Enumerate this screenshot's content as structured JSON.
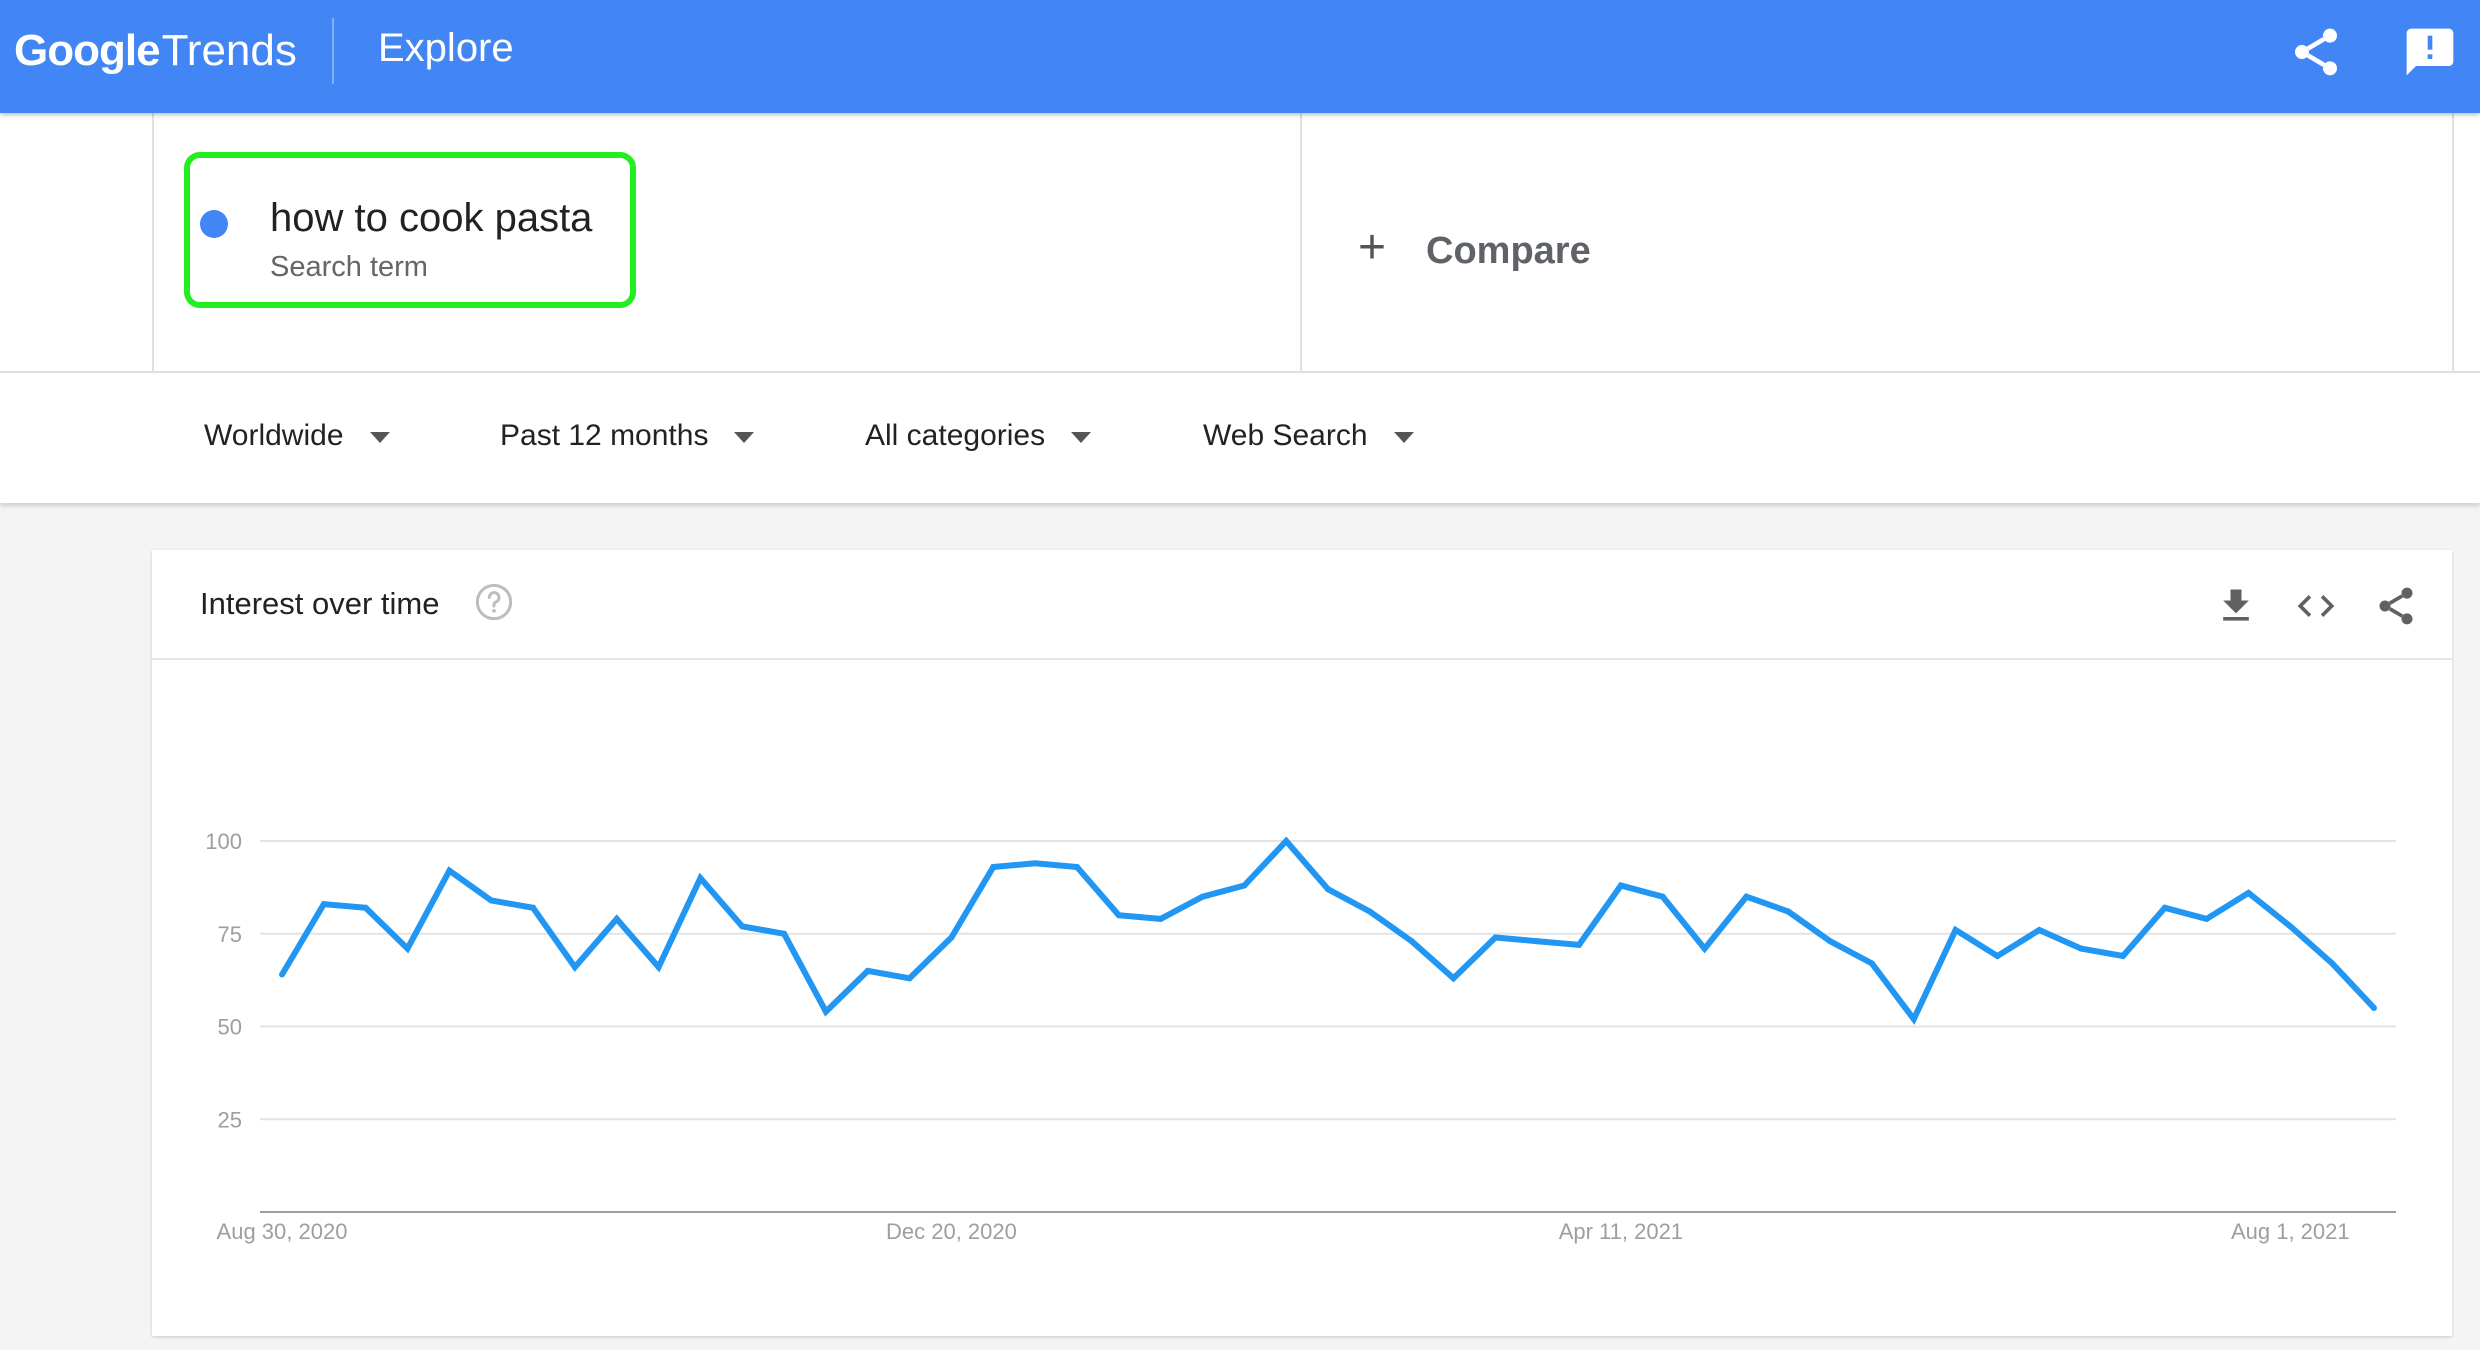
{
  "header": {
    "logo_google": "Google",
    "logo_trends": "Trends",
    "title": "Explore",
    "icons": [
      "share-icon",
      "feedback-icon"
    ],
    "color": "#4285f4"
  },
  "search": {
    "term": "how to cook pasta",
    "term_sub": "Search term",
    "term_color": "#4285f4",
    "highlight_color": "#22ee22",
    "compare_label": "Compare"
  },
  "filters": {
    "region": "Worldwide",
    "time": "Past 12 months",
    "category": "All categories",
    "search_type": "Web Search"
  },
  "card": {
    "title": "Interest over time",
    "icons": [
      "help-icon",
      "download-icon",
      "embed-code-icon",
      "share-icon"
    ]
  },
  "chart_data": {
    "type": "line",
    "title": "Interest over time",
    "series": [
      {
        "name": "how to cook pasta",
        "color": "#2196f3",
        "values": [
          64,
          83,
          82,
          71,
          92,
          84,
          82,
          66,
          79,
          66,
          90,
          77,
          75,
          54,
          65,
          63,
          74,
          93,
          94,
          93,
          80,
          79,
          85,
          88,
          100,
          87,
          81,
          73,
          63,
          74,
          73,
          72,
          88,
          85,
          71,
          85,
          81,
          73,
          67,
          52,
          76,
          69,
          76,
          71,
          69,
          82,
          79,
          86,
          77,
          67,
          55
        ]
      }
    ],
    "x_tick_labels": [
      "Aug 30, 2020",
      "Dec 20, 2020",
      "Apr 11, 2021",
      "Aug 1, 2021"
    ],
    "x_tick_indices": [
      0,
      16,
      32,
      48
    ],
    "y_ticks": [
      25,
      50,
      75,
      100
    ],
    "ylim": [
      0,
      100
    ],
    "grid": true
  }
}
